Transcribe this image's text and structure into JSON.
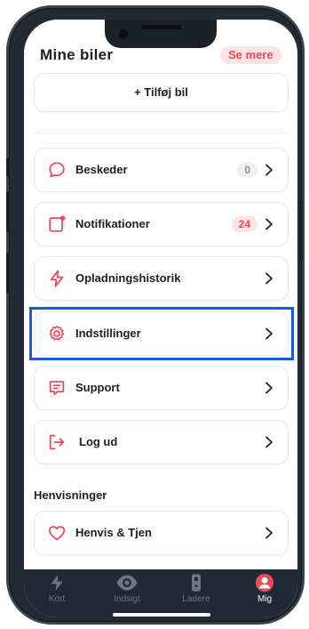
{
  "header": {
    "title": "Mine biler",
    "see_more": "Se mere"
  },
  "add_car": {
    "label": "+ Tilføj bil"
  },
  "menu": {
    "items": [
      {
        "label": "Beskeder",
        "badge": "0"
      },
      {
        "label": "Notifikationer",
        "badge": "24"
      },
      {
        "label": "Opladningshistorik"
      },
      {
        "label": "Indstillinger"
      },
      {
        "label": "Support"
      },
      {
        "label": "Log ud"
      }
    ]
  },
  "referrals": {
    "heading": "Henvisninger",
    "items": [
      {
        "label": "Henvis & Tjen"
      }
    ]
  },
  "tabbar": {
    "tabs": [
      {
        "label": "Kort",
        "icon": "bolt-icon"
      },
      {
        "label": "Indsigt",
        "icon": "eye-icon"
      },
      {
        "label": "Ladere",
        "icon": "charger-icon"
      },
      {
        "label": "Mig",
        "icon": "profile-icon",
        "active": true
      }
    ]
  },
  "colors": {
    "accent": "#e84b57",
    "highlight": "#1f5bc7",
    "tabbar": "#1f2a36"
  }
}
